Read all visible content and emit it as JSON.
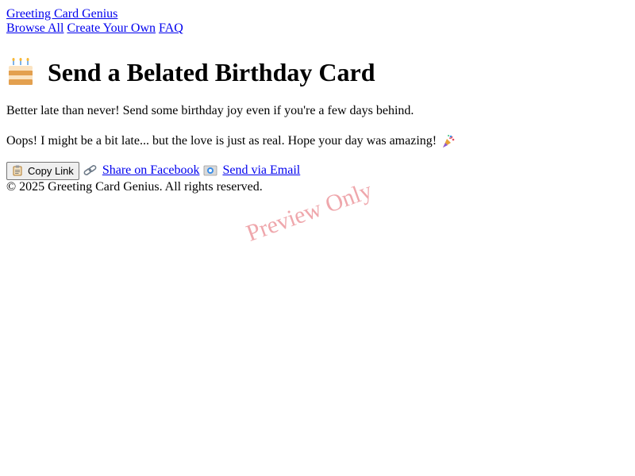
{
  "header": {
    "site_title": "Greeting Card Genius",
    "nav": [
      "Browse All",
      "Create Your Own",
      "FAQ"
    ]
  },
  "main": {
    "heading": "Send a Belated Birthday Card",
    "heading_icon": "birthday-cake-icon",
    "intro": "Better late than never! Send some birthday joy even if you're a few days behind.",
    "message": "Oops! I might be a bit late... but the love is just as real. Hope your day was amazing!",
    "message_icon": "party-popper-icon"
  },
  "actions": {
    "copy_label": "Copy Link",
    "copy_icon": "clipboard-icon",
    "facebook_label": "Share on Facebook",
    "facebook_icon": "link-icon",
    "email_label": "Send via Email",
    "email_icon": "email-icon"
  },
  "footer": {
    "copyright": "© 2025 Greeting Card Genius. All rights reserved."
  },
  "watermark": "Preview Only",
  "colors": {
    "link": "#0000ee",
    "watermark": "#dc3c46"
  }
}
